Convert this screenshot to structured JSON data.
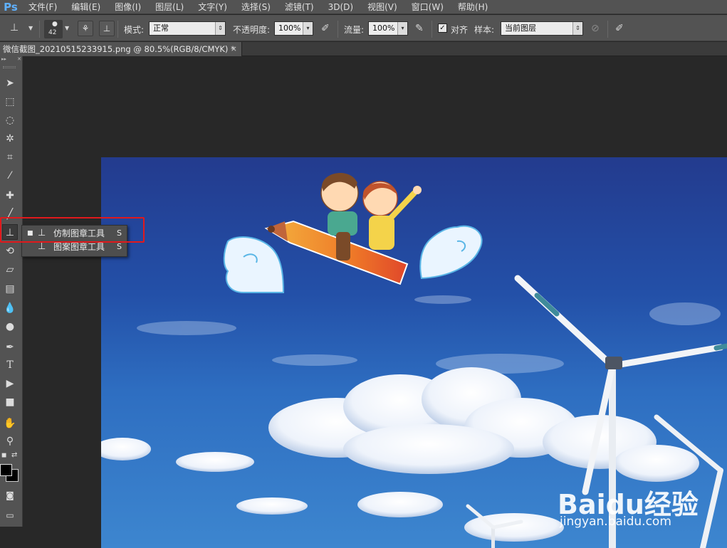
{
  "app": {
    "logo": "Ps"
  },
  "menu": [
    "文件(F)",
    "编辑(E)",
    "图像(I)",
    "图层(L)",
    "文字(Y)",
    "选择(S)",
    "滤镜(T)",
    "3D(D)",
    "视图(V)",
    "窗口(W)",
    "帮助(H)"
  ],
  "options": {
    "brush_size": "42",
    "mode_label": "模式:",
    "mode_value": "正常",
    "opacity_label": "不透明度:",
    "opacity_value": "100%",
    "flow_label": "流量:",
    "flow_value": "100%",
    "align_label": "对齐",
    "align_checked": true,
    "sample_label": "样本:",
    "sample_value": "当前图层"
  },
  "document": {
    "tab_title": "微信截图_20210515233915.png @ 80.5%(RGB/8/CMYK) *",
    "close": "×"
  },
  "flyout": {
    "items": [
      {
        "label": "仿制图章工具",
        "key": "S",
        "selected": true
      },
      {
        "label": "图案图章工具",
        "key": "S",
        "selected": false
      }
    ]
  },
  "watermark": {
    "brand": "Baidu经验",
    "url": "jingyan.baidu.com"
  },
  "colors": {
    "highlight": "#e1191c",
    "ps_blue": "#5fb1ff",
    "panel": "#535353"
  }
}
